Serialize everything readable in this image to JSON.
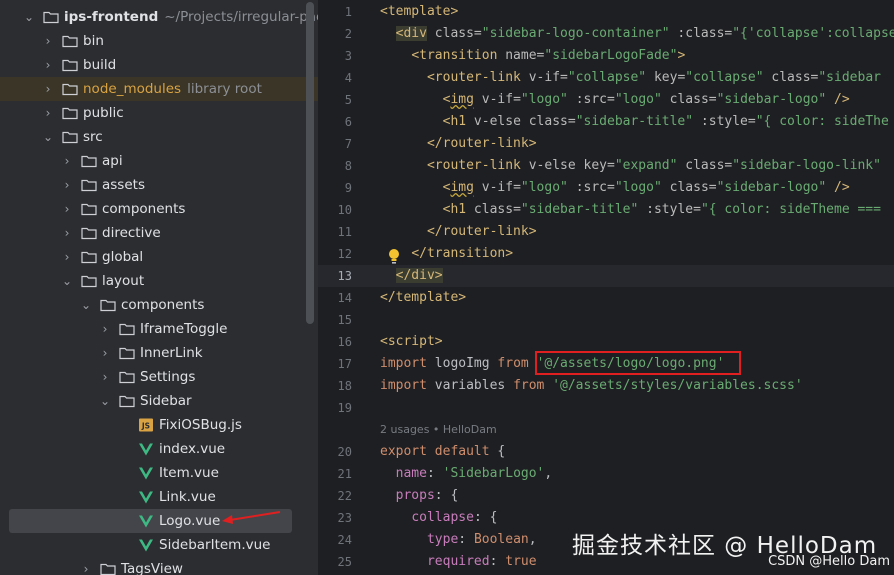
{
  "tree": {
    "items": [
      {
        "name": "ips-frontend",
        "hint": "~/Projects/irregular-packing",
        "type": "folder",
        "open": true,
        "bold": true
      },
      {
        "name": "bin",
        "type": "folder",
        "open": false
      },
      {
        "name": "build",
        "type": "folder",
        "open": false
      },
      {
        "name": "node_modules",
        "hint": "library root",
        "type": "folder",
        "open": false,
        "library": true
      },
      {
        "name": "public",
        "type": "folder",
        "open": false
      },
      {
        "name": "src",
        "type": "folder",
        "open": true
      },
      {
        "name": "api",
        "type": "folder",
        "open": false
      },
      {
        "name": "assets",
        "type": "folder",
        "open": false
      },
      {
        "name": "components",
        "type": "folder",
        "open": false
      },
      {
        "name": "directive",
        "type": "folder",
        "open": false
      },
      {
        "name": "global",
        "type": "folder",
        "open": false
      },
      {
        "name": "layout",
        "type": "folder",
        "open": true
      },
      {
        "name": "components",
        "type": "folder",
        "open": true
      },
      {
        "name": "IframeToggle",
        "type": "folder",
        "open": false
      },
      {
        "name": "InnerLink",
        "type": "folder",
        "open": false
      },
      {
        "name": "Settings",
        "type": "folder",
        "open": false
      },
      {
        "name": "Sidebar",
        "type": "folder",
        "open": true
      },
      {
        "name": "FixiOSBug.js",
        "type": "js"
      },
      {
        "name": "index.vue",
        "type": "vue"
      },
      {
        "name": "Item.vue",
        "type": "vue"
      },
      {
        "name": "Link.vue",
        "type": "vue"
      },
      {
        "name": "Logo.vue",
        "type": "vue",
        "selected": true
      },
      {
        "name": "SidebarItem.vue",
        "type": "vue"
      },
      {
        "name": "TagsView",
        "type": "folder",
        "open": false
      }
    ]
  },
  "editor": {
    "current_line": "13",
    "lines": [
      {
        "n": "1",
        "parts": [
          [
            "t",
            "<template>"
          ]
        ]
      },
      {
        "n": "2",
        "parts": [
          [
            "x",
            "  "
          ],
          [
            "tg",
            "<div"
          ],
          [
            "a",
            " class="
          ],
          [
            "s",
            "\"sidebar-logo-container\""
          ],
          [
            "a",
            " :class="
          ],
          [
            "s",
            "\"{'collapse':collapse"
          ]
        ]
      },
      {
        "n": "3",
        "parts": [
          [
            "x",
            "    "
          ],
          [
            "t",
            "<transition"
          ],
          [
            "a",
            " name="
          ],
          [
            "s",
            "\"sidebarLogoFade\""
          ],
          [
            "t",
            ">"
          ]
        ]
      },
      {
        "n": "4",
        "parts": [
          [
            "x",
            "      "
          ],
          [
            "t",
            "<router-link"
          ],
          [
            "a",
            " v-if="
          ],
          [
            "s",
            "\"collapse\""
          ],
          [
            "a",
            " key="
          ],
          [
            "s",
            "\"collapse\""
          ],
          [
            "a",
            " class="
          ],
          [
            "s",
            "\"sidebar"
          ]
        ]
      },
      {
        "n": "5",
        "parts": [
          [
            "x",
            "        "
          ],
          [
            "t",
            "<"
          ],
          [
            "timg",
            "img"
          ],
          [
            "a",
            " v-if="
          ],
          [
            "s",
            "\"logo\""
          ],
          [
            "a",
            " :src="
          ],
          [
            "s",
            "\"logo\""
          ],
          [
            "a",
            " class="
          ],
          [
            "s",
            "\"sidebar-logo\""
          ],
          [
            "t",
            " />"
          ]
        ]
      },
      {
        "n": "6",
        "parts": [
          [
            "x",
            "        "
          ],
          [
            "t",
            "<h1"
          ],
          [
            "a",
            " v-else class="
          ],
          [
            "s",
            "\"sidebar-title\""
          ],
          [
            "a",
            " :style="
          ],
          [
            "s",
            "\"{ color: sideThe"
          ]
        ]
      },
      {
        "n": "7",
        "parts": [
          [
            "x",
            "      "
          ],
          [
            "t",
            "</router-link>"
          ]
        ]
      },
      {
        "n": "8",
        "parts": [
          [
            "x",
            "      "
          ],
          [
            "t",
            "<router-link"
          ],
          [
            "a",
            " v-else key="
          ],
          [
            "s",
            "\"expand\""
          ],
          [
            "a",
            " class="
          ],
          [
            "s",
            "\"sidebar-logo-link\""
          ]
        ]
      },
      {
        "n": "9",
        "parts": [
          [
            "x",
            "        "
          ],
          [
            "t",
            "<"
          ],
          [
            "timg",
            "img"
          ],
          [
            "a",
            " v-if="
          ],
          [
            "s",
            "\"logo\""
          ],
          [
            "a",
            " :src="
          ],
          [
            "s",
            "\"logo\""
          ],
          [
            "a",
            " class="
          ],
          [
            "s",
            "\"sidebar-logo\""
          ],
          [
            "t",
            " />"
          ]
        ]
      },
      {
        "n": "10",
        "parts": [
          [
            "x",
            "        "
          ],
          [
            "t",
            "<h1"
          ],
          [
            "a",
            " class="
          ],
          [
            "s",
            "\"sidebar-title\""
          ],
          [
            "a",
            " :style="
          ],
          [
            "s",
            "\"{ color: sideTheme ==="
          ]
        ]
      },
      {
        "n": "11",
        "parts": [
          [
            "x",
            "      "
          ],
          [
            "t",
            "</router-link>"
          ]
        ]
      },
      {
        "n": "12",
        "parts": [
          [
            "x",
            "    "
          ],
          [
            "t",
            "</transition>"
          ]
        ]
      },
      {
        "n": "13",
        "parts": [
          [
            "x",
            "  "
          ],
          [
            "tg",
            "</div>"
          ]
        ]
      },
      {
        "n": "14",
        "parts": [
          [
            "t",
            "</template>"
          ]
        ]
      },
      {
        "n": "15",
        "parts": []
      },
      {
        "n": "16",
        "parts": [
          [
            "t",
            "<script>"
          ]
        ]
      },
      {
        "n": "17",
        "parts": [
          [
            "k",
            "import"
          ],
          [
            "x",
            " logoImg "
          ],
          [
            "k",
            "from"
          ],
          [
            "x",
            " "
          ],
          [
            "s",
            "'@/assets/logo/logo.png'"
          ]
        ]
      },
      {
        "n": "18",
        "parts": [
          [
            "k",
            "import"
          ],
          [
            "x",
            " variables "
          ],
          [
            "k",
            "from"
          ],
          [
            "x",
            " "
          ],
          [
            "s",
            "'@/assets/styles/variables.scss'"
          ]
        ]
      },
      {
        "n": "19",
        "parts": []
      },
      {
        "n": "",
        "hint": "2 usages   • HelloDam"
      },
      {
        "n": "20",
        "parts": [
          [
            "k",
            "export default"
          ],
          [
            "x",
            " {"
          ]
        ]
      },
      {
        "n": "21",
        "parts": [
          [
            "x",
            "  "
          ],
          [
            "p",
            "name"
          ],
          [
            "x",
            ": "
          ],
          [
            "s",
            "'SidebarLogo'"
          ],
          [
            "x",
            ","
          ]
        ]
      },
      {
        "n": "22",
        "parts": [
          [
            "x",
            "  "
          ],
          [
            "p",
            "props"
          ],
          [
            "x",
            ": {"
          ]
        ]
      },
      {
        "n": "23",
        "parts": [
          [
            "x",
            "    "
          ],
          [
            "p",
            "collapse"
          ],
          [
            "x",
            ": {"
          ]
        ]
      },
      {
        "n": "24",
        "parts": [
          [
            "x",
            "      "
          ],
          [
            "p",
            "type"
          ],
          [
            "x",
            ": "
          ],
          [
            "k",
            "Boolean"
          ],
          [
            "x",
            ","
          ]
        ]
      },
      {
        "n": "25",
        "parts": [
          [
            "x",
            "      "
          ],
          [
            "p",
            "required"
          ],
          [
            "x",
            ": "
          ],
          [
            "k",
            "true"
          ]
        ]
      }
    ]
  },
  "watermark": "掘金技术社区 @ HelloDam",
  "csdn": "CSDN @Hello Dam",
  "colors": {
    "highlight_box": "#e02020",
    "arrow": "#e02020"
  }
}
